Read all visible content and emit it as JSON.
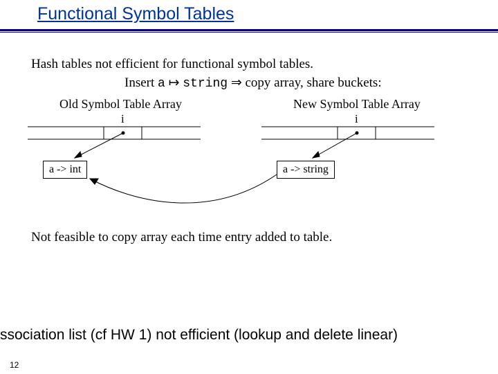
{
  "title": "Functional Symbol Tables",
  "body": {
    "line1": "Hash tables not efficient for functional symbol tables.",
    "line2_prefix": "Insert ",
    "line2_a": "a",
    "line2_mapsto": " ↦ ",
    "line2_string": "string",
    "line2_arrow": " ⇒ ",
    "line2_suffix": "copy array, share buckets:",
    "old_label": "Old Symbol Table Array",
    "new_label": "New  Symbol Table Array",
    "i_left": "i",
    "i_right": "i",
    "box_left": "a -> int",
    "box_right": "a -> string",
    "line3": "Not feasible to copy array each time entry added to table."
  },
  "bottom_note": "ssociation list (cf HW 1) not efficient (lookup and delete linear)",
  "page_number": "12"
}
